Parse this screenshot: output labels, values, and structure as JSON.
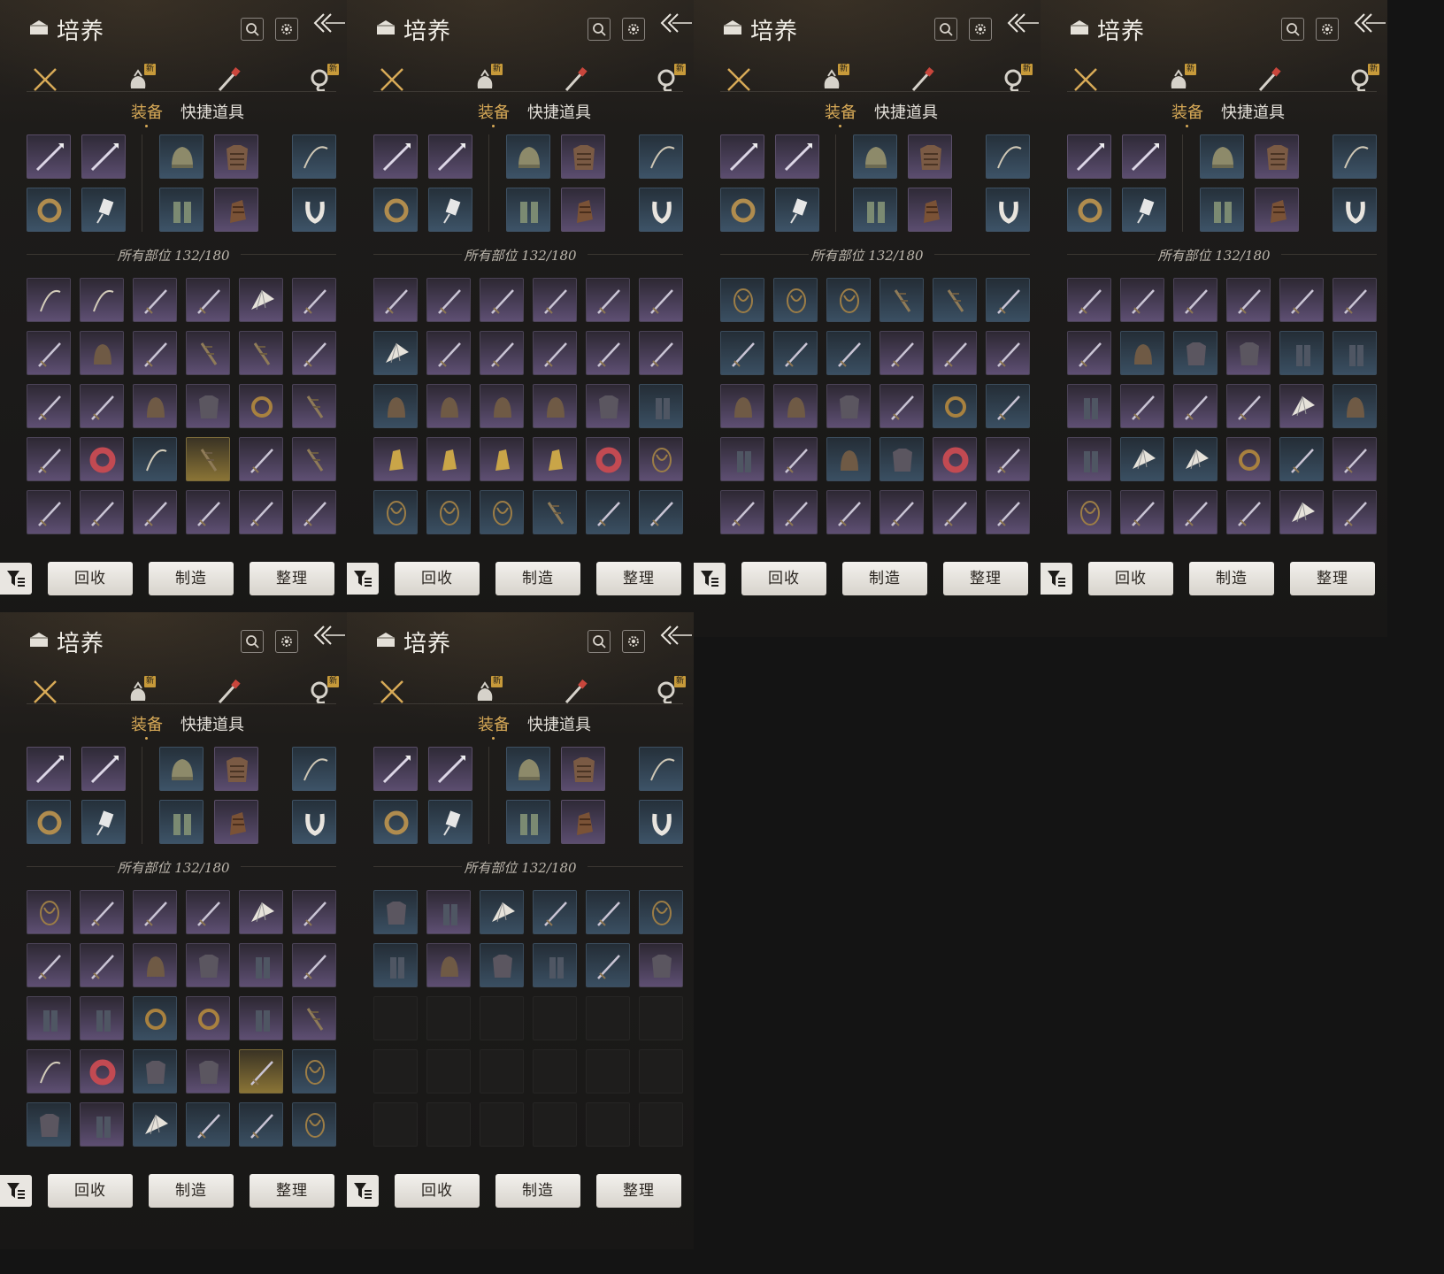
{
  "screen": {
    "title": "培养",
    "title_icon": "scroll-box-icon",
    "search_icon": "search-icon",
    "settings_icon": "gear-icon",
    "back_icon": "double-chevron-back-icon",
    "tabs": [
      {
        "icon": "crossed-swords-icon",
        "active": true,
        "new": false
      },
      {
        "icon": "money-pouch-icon",
        "active": false,
        "new": true
      },
      {
        "icon": "scroll-brush-icon",
        "active": false,
        "new": false
      },
      {
        "icon": "rune-token-icon",
        "active": false,
        "new": true
      }
    ],
    "new_badge": "新",
    "subtabs": [
      "装备",
      "快捷道具"
    ],
    "active_subtab": "装备",
    "inventory_count": "所有部位 132/180",
    "actions": {
      "recycle": "回收",
      "craft": "制造",
      "sort": "整理"
    },
    "filter_icon": "filter-list-icon",
    "colors": {
      "accent": "#d8aa57",
      "purple_rarity": "#5e4f73",
      "blue_rarity": "#3a4f62",
      "gold_rarity": "#8a7436"
    }
  },
  "equipped": [
    {
      "icon": "spear-icon",
      "rarity": "purple"
    },
    {
      "icon": "spear-icon",
      "rarity": "purple"
    },
    {
      "icon": "helmet-icon",
      "rarity": "blue"
    },
    {
      "icon": "armor-icon",
      "rarity": "purple"
    },
    {
      "icon": "bow-icon",
      "rarity": "blue"
    },
    {
      "icon": "ring-icon",
      "rarity": "blue"
    },
    {
      "icon": "talisman-icon",
      "rarity": "blue"
    },
    {
      "icon": "leg-armor-icon",
      "rarity": "blue"
    },
    {
      "icon": "gauntlet-icon",
      "rarity": "purple"
    },
    {
      "icon": "necklace-icon",
      "rarity": "blue"
    }
  ],
  "panels": [
    {
      "id": "p1",
      "items": [
        "bp",
        "bp",
        "sp",
        "sp",
        "fp",
        "sp",
        "sp",
        "hp",
        "sp",
        "wp",
        "wp",
        "sp",
        "sp",
        "sp",
        "hp",
        "ap",
        "rp",
        "wp",
        "sp",
        "kr",
        "bb",
        "wg",
        "sp",
        "wp",
        "sp",
        "sp",
        "sp",
        "sp",
        "sp",
        "sp"
      ]
    },
    {
      "id": "p2",
      "items": [
        "sp",
        "sp",
        "sp",
        "sp",
        "sp",
        "sp",
        "fb",
        "sp",
        "sp",
        "sp",
        "sp",
        "sp",
        "hb",
        "hp",
        "hp",
        "hp",
        "ap",
        "gb",
        "cp",
        "cp",
        "cp",
        "cp",
        "kp",
        "np",
        "nb",
        "nb",
        "nb",
        "wb",
        "sb",
        "sb"
      ]
    },
    {
      "id": "p3",
      "items": [
        "nb",
        "nb",
        "nb",
        "wb",
        "wb",
        "sb",
        "sb",
        "sb",
        "sb",
        "sp",
        "sp",
        "sp",
        "hp",
        "hp",
        "ap",
        "sp",
        "rb",
        "sb",
        "gp",
        "sp",
        "hb",
        "ab",
        "kp",
        "sp",
        "sp",
        "sp",
        "sp",
        "sp",
        "sp",
        "sp"
      ]
    },
    {
      "id": "p4",
      "items": [
        "sp",
        "sp",
        "sp",
        "sp",
        "sp",
        "sp",
        "sp",
        "hb",
        "ab",
        "ap",
        "gb",
        "gb",
        "gp",
        "sp",
        "sp",
        "sp",
        "fp",
        "hb",
        "gp",
        "fb",
        "fb",
        "rp",
        "sb",
        "sp",
        "np",
        "sp",
        "sp",
        "sp",
        "fp",
        "sp"
      ]
    },
    {
      "id": "p5",
      "items": [
        "np",
        "sp",
        "sp",
        "sp",
        "fp",
        "sp",
        "sp",
        "sp",
        "hp",
        "ap",
        "gp",
        "sp",
        "gp",
        "gp",
        "rb",
        "rp",
        "gp",
        "wp",
        "bp",
        "kr",
        "ab",
        "ar",
        "sg",
        "nb",
        "ab",
        "gp",
        "fb",
        "sb",
        "sb",
        "nb"
      ]
    },
    {
      "id": "p6",
      "items": [
        "ab",
        "gp",
        "fb",
        "sb",
        "sb",
        "nb",
        "gb",
        "hp",
        "ab",
        "gb",
        "sb",
        "ap",
        "ee",
        "ee",
        "ee",
        "ee",
        "ee",
        "ee",
        "ee",
        "ee",
        "ee",
        "ee",
        "ee",
        "ee",
        "ee",
        "ee",
        "ee",
        "ee",
        "ee",
        "ee"
      ]
    }
  ]
}
